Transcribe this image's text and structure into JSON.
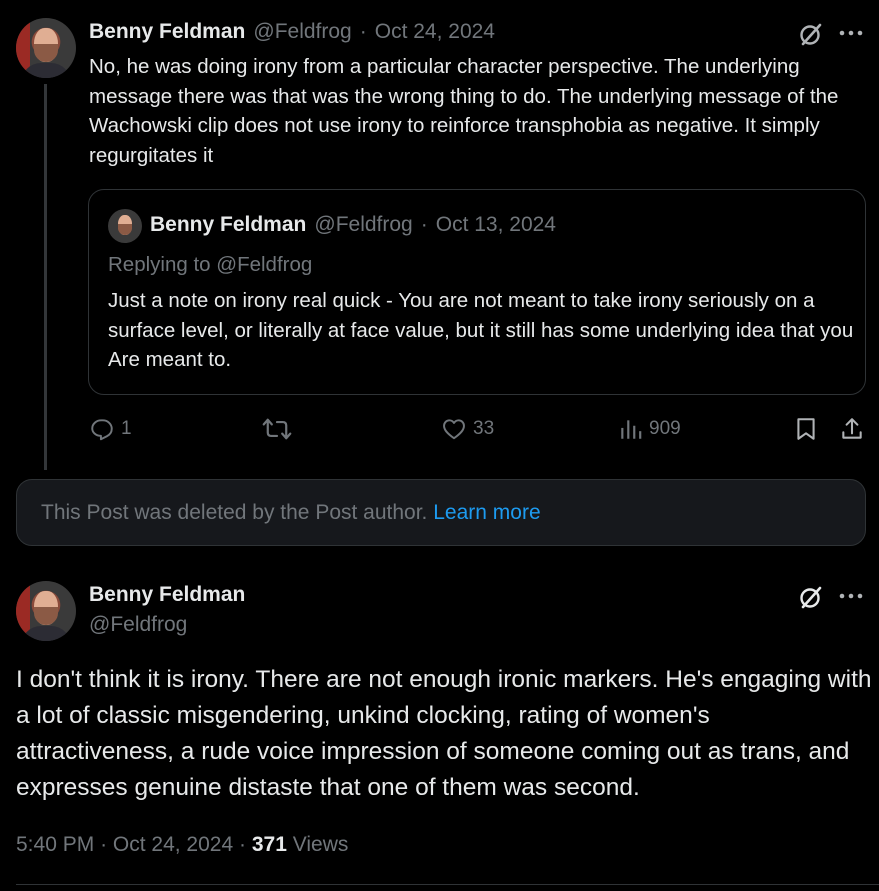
{
  "reply": {
    "author_name": "Benny Feldman",
    "author_handle": "@Feldfrog",
    "separator": "·",
    "date": "Oct 24, 2024",
    "text": "No, he was doing irony from a particular character perspective. The underlying message there was that was the wrong thing to do. The underlying message of the Wachowski clip does not use irony to reinforce transphobia as negative. It simply regurgitates it",
    "quote": {
      "author_name": "Benny Feldman",
      "author_handle": "@Feldfrog",
      "separator": "·",
      "date": "Oct 13, 2024",
      "replying_to": "Replying to @Feldfrog",
      "text": "Just a note on irony real quick - You are not meant to take irony seriously on a surface level, or literally at face value, but it still has some underlying idea that you Are meant to."
    },
    "actions": {
      "replies": "1",
      "reposts": "",
      "likes": "33",
      "views": "909"
    }
  },
  "deleted_notice": {
    "text": "This Post was deleted by the Post author.",
    "link": "Learn more"
  },
  "main_post": {
    "author_name": "Benny Feldman",
    "author_handle": "@Feldfrog",
    "text": "I don't think it is irony. There are not enough ironic markers. He's engaging with a lot of classic misgendering, unkind clocking, rating of women's attractiveness, a rude voice impression of someone coming out as trans, and expresses genuine distaste that one of them was second.",
    "time": "5:40 PM",
    "separator": "·",
    "date": "Oct 24, 2024",
    "views_count": "371",
    "views_label": "Views"
  },
  "colors": {
    "background": "#000000",
    "text": "#e7e9ea",
    "muted": "#71767b",
    "border": "#2f3336",
    "link": "#1d9bf0"
  }
}
